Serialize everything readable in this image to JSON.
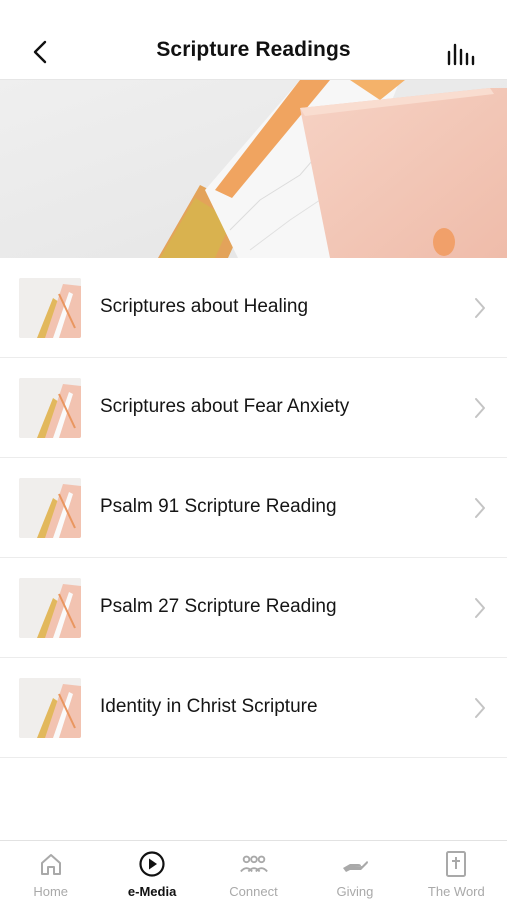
{
  "header": {
    "title": "Scripture Readings",
    "back_icon": "chevron-left-icon",
    "audio_icon": "audio-bars-icon"
  },
  "hero": {
    "image": "pink-notebooks-on-marble"
  },
  "items": [
    {
      "label": "Scriptures about Healing"
    },
    {
      "label": "Scriptures about Fear Anxiety"
    },
    {
      "label": "Psalm 91 Scripture Reading"
    },
    {
      "label": "Psalm 27 Scripture Reading"
    },
    {
      "label": "Identity in Christ Scripture"
    }
  ],
  "tabs": [
    {
      "label": "Home",
      "icon": "home-icon",
      "active": false
    },
    {
      "label": "e-Media",
      "icon": "play-circle-icon",
      "active": true
    },
    {
      "label": "Connect",
      "icon": "group-icon",
      "active": false
    },
    {
      "label": "Giving",
      "icon": "giving-hand-icon",
      "active": false
    },
    {
      "label": "The Word",
      "icon": "bible-icon",
      "active": false
    }
  ],
  "colors": {
    "active_tab": "#111111",
    "inactive_tab": "#a9a9a9",
    "divider": "#ececec"
  }
}
